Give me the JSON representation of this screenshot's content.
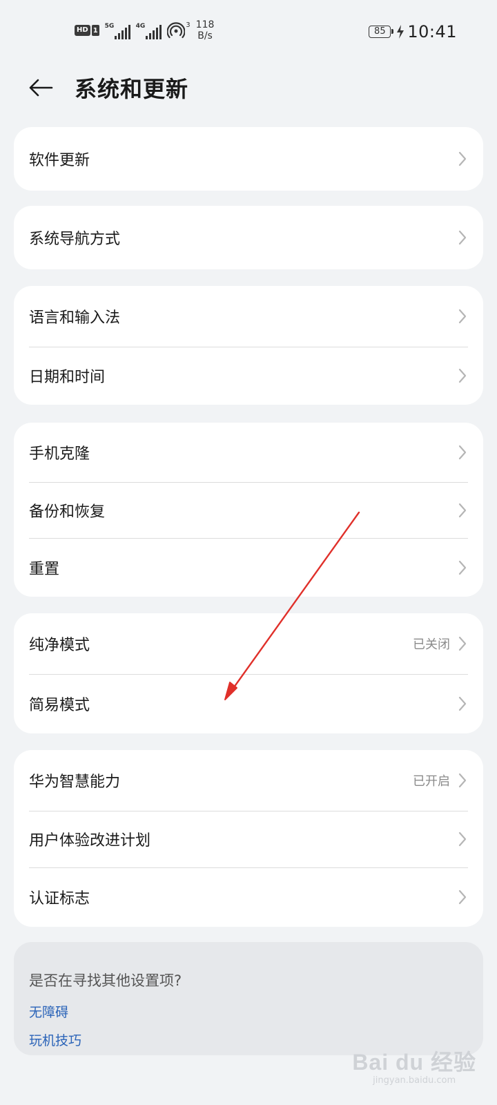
{
  "status_bar": {
    "hd_label": "HD",
    "sim1_label": "1",
    "net1_type": "5G",
    "net2_type": "4G",
    "hotspot_count": "3",
    "speed_value": "118",
    "speed_unit": "B/s",
    "battery_level": "85",
    "time": "10:41"
  },
  "header": {
    "title": "系统和更新"
  },
  "groups": [
    {
      "items": [
        {
          "label": "软件更新",
          "value": ""
        }
      ]
    },
    {
      "items": [
        {
          "label": "系统导航方式",
          "value": ""
        }
      ]
    },
    {
      "items": [
        {
          "label": "语言和输入法",
          "value": ""
        },
        {
          "label": "日期和时间",
          "value": ""
        }
      ]
    },
    {
      "items": [
        {
          "label": "手机克隆",
          "value": ""
        },
        {
          "label": "备份和恢复",
          "value": ""
        },
        {
          "label": "重置",
          "value": ""
        }
      ]
    },
    {
      "items": [
        {
          "label": "纯净模式",
          "value": "已关闭"
        },
        {
          "label": "简易模式",
          "value": ""
        }
      ]
    },
    {
      "items": [
        {
          "label": "华为智慧能力",
          "value": "已开启"
        },
        {
          "label": "用户体验改进计划",
          "value": ""
        },
        {
          "label": "认证标志",
          "value": ""
        }
      ]
    }
  ],
  "suggestions": {
    "title": "是否在寻找其他设置项?",
    "links": [
      "无障碍",
      "玩机技巧"
    ]
  },
  "annotation": {
    "color": "#e0302a"
  },
  "watermark": {
    "logo": "Bai du 经验",
    "url": "jingyan.baidu.com"
  },
  "icons": {
    "back": "arrow-left-icon",
    "chevron": "chevron-right-icon",
    "hotspot": "hotspot-icon",
    "charging": "charging-bolt-icon"
  }
}
